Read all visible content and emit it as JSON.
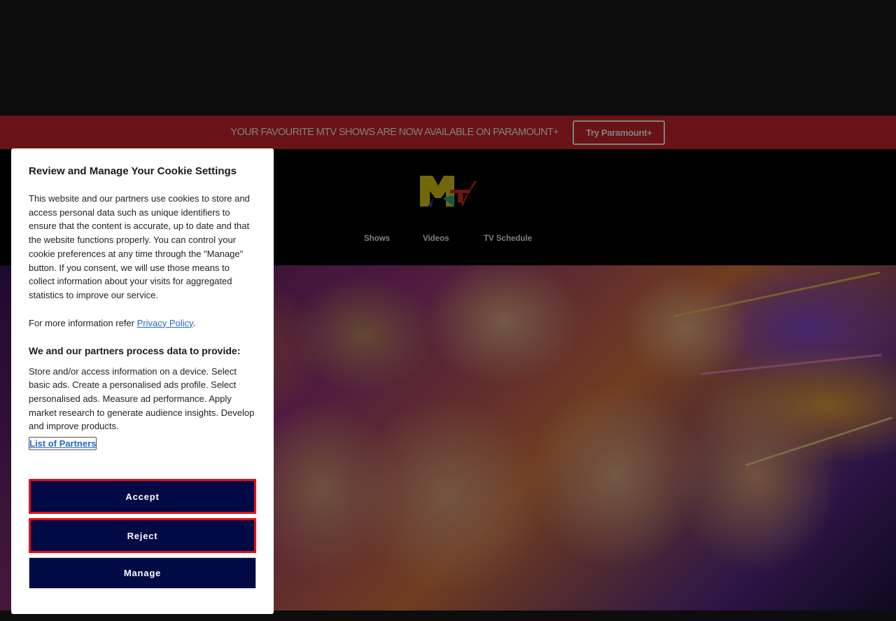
{
  "promo": {
    "text": "YOUR FAVOURITE MTV SHOWS ARE NOW AVAILABLE ON PARAMOUNT+",
    "button_label": "Try Paramount+",
    "background_color": "#d2262c"
  },
  "header": {
    "logo_icon": "mtv-logo-icon",
    "nav": [
      "Shows",
      "Videos",
      "TV Schedule"
    ]
  },
  "cookie": {
    "title": "Review and Manage Your Cookie Settings",
    "body": "This website and our partners use cookies to store and access personal data such as unique identifiers to ensure that the content is accurate, up to date and that the website functions properly. You can control your cookie preferences at any time through the \"Manage\" button. If you consent, we will use those means to collect information about your visits for aggregated statistics to improve our service.",
    "more_prefix": "For more information refer ",
    "privacy_link": "Privacy Policy",
    "more_suffix": ".",
    "subtitle": "We and our partners process data to provide:",
    "purposes": "Store and/or access information on a device. Select basic ads. Create a personalised ads profile. Select personalised ads. Measure ad performance. Apply market research to generate audience insights. Develop and improve products.",
    "partners_link": "List of Partners",
    "accept_label": "Accept",
    "reject_label": "Reject",
    "manage_label": "Manage",
    "button_color": "#020a46",
    "highlight_color": "#e5101a"
  }
}
